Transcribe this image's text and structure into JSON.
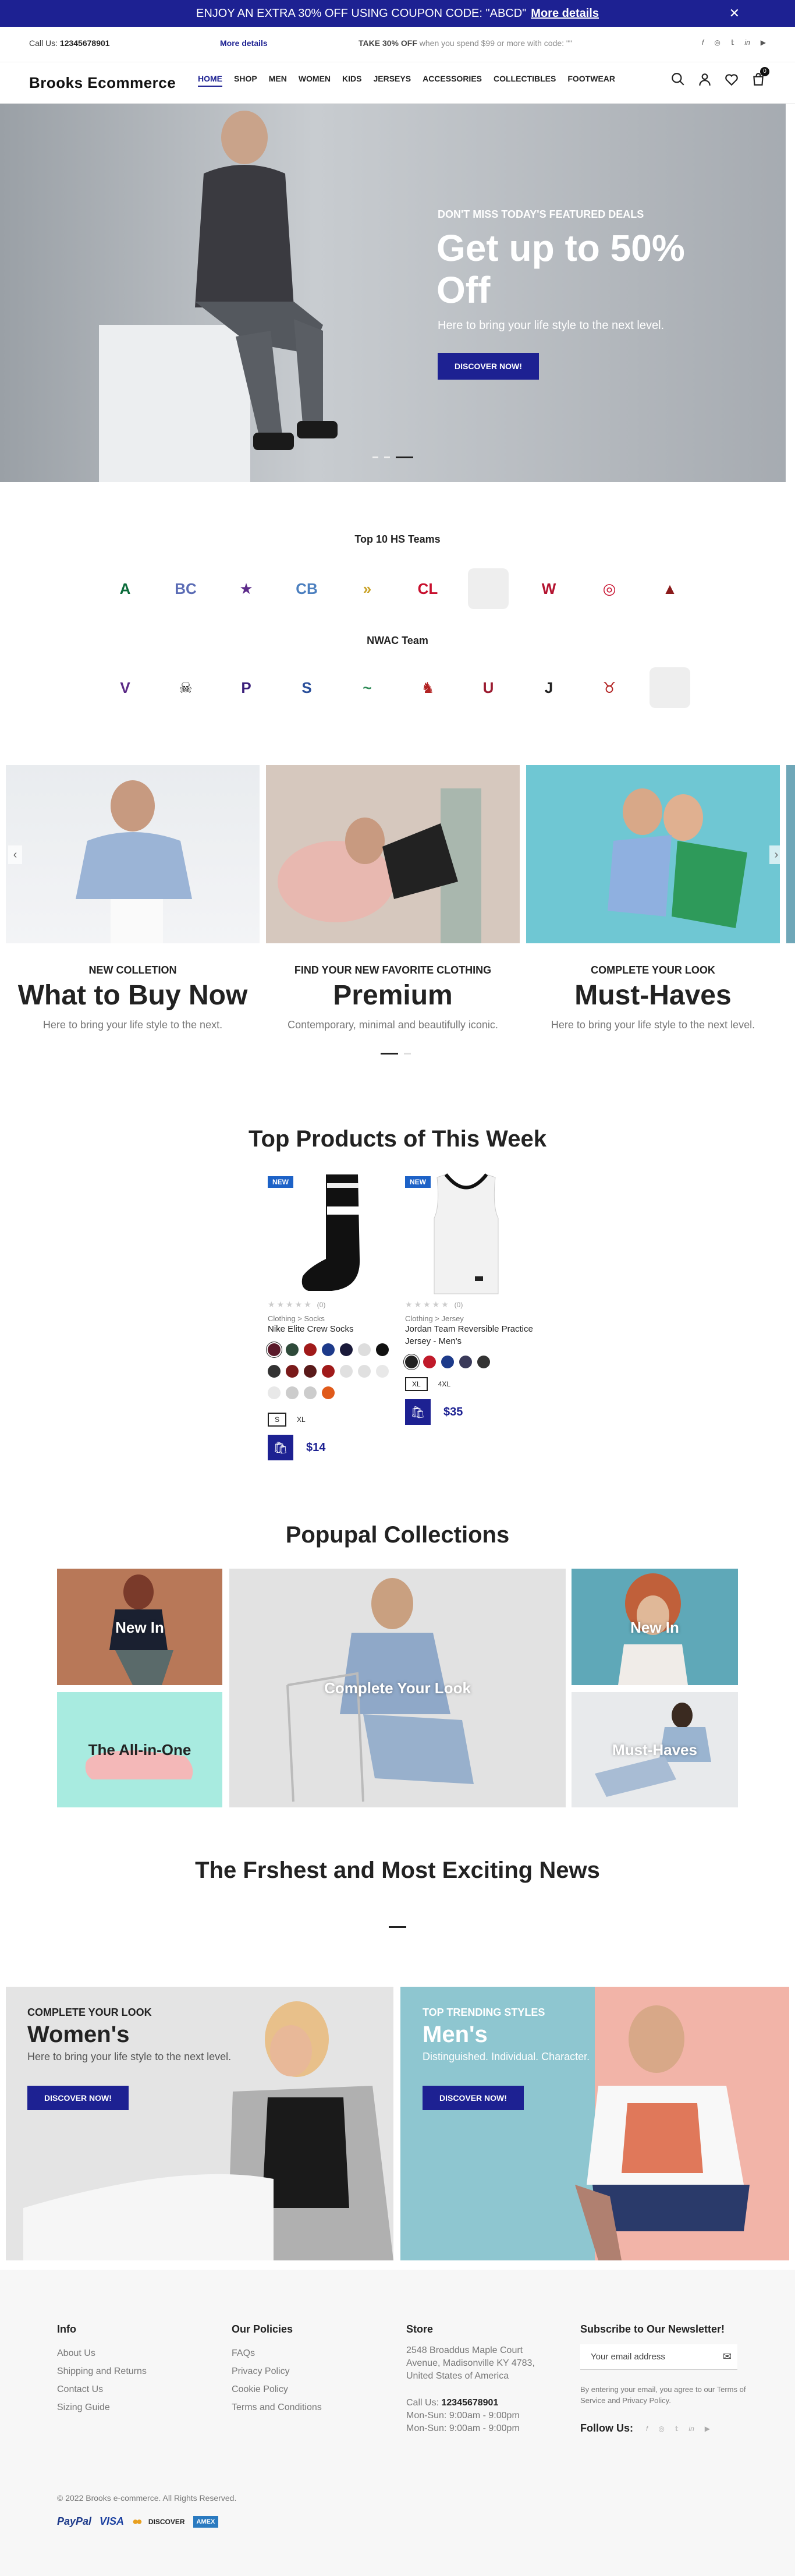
{
  "promo": {
    "text": "ENJOY AN EXTRA 30% OFF USING COUPON CODE: \"ABCD\"",
    "link": "More details",
    "close": "✕"
  },
  "topbar": {
    "call_label": "Call Us:",
    "phone": "12345678901",
    "more": "More details",
    "offer_strong": "TAKE 30% OFF",
    "offer_rest": "when you spend $99 or more with code: \"\"",
    "social": [
      "f",
      "◎",
      "𝕥",
      "in",
      "▶"
    ]
  },
  "header": {
    "logo": "Brooks Ecommerce",
    "menu": [
      "HOME",
      "SHOP",
      "MEN",
      "WOMEN",
      "KIDS",
      "JERSEYS",
      "ACCESSORIES",
      "COLLECTIBLES",
      "FOOTWEAR"
    ],
    "cart_count": "0"
  },
  "hero": {
    "subtitle": "DON'T MISS TODAY'S FEATURED DEALS",
    "title": "Get up to 50% Off",
    "desc": "Here to bring your life style to the next level.",
    "button": "DISCOVER NOW!"
  },
  "teams": {
    "hs_title": "Top 10 HS Teams",
    "hs": [
      {
        "t": "A",
        "c": "#0b6b3a"
      },
      {
        "t": "BC",
        "c": "#5b6cb5"
      },
      {
        "t": "★",
        "c": "#5c2a8a"
      },
      {
        "t": "CB",
        "c": "#4b7fbf"
      },
      {
        "t": "»",
        "c": "#c9a227"
      },
      {
        "t": "CL",
        "c": "#c8102e"
      },
      {
        "t": "",
        "c": "#eeeeee"
      },
      {
        "t": "W",
        "c": "#b3122f"
      },
      {
        "t": "◎",
        "c": "#c8102e"
      },
      {
        "t": "▲",
        "c": "#8a1a1a"
      }
    ],
    "nwac_title": "NWAC Team",
    "nwac": [
      {
        "t": "V",
        "c": "#5b2a86"
      },
      {
        "t": "☠",
        "c": "#222222"
      },
      {
        "t": "P",
        "c": "#3a1f7a"
      },
      {
        "t": "S",
        "c": "#2a4f9a"
      },
      {
        "t": "~",
        "c": "#2e8b57"
      },
      {
        "t": "♞",
        "c": "#b22222"
      },
      {
        "t": "U",
        "c": "#9b1b30"
      },
      {
        "t": "J",
        "c": "#222222"
      },
      {
        "t": "♉",
        "c": "#b22222"
      },
      {
        "t": "",
        "c": "#eeeeee"
      }
    ]
  },
  "collections": [
    {
      "sub": "NEW COLLETION",
      "title": "What to Buy Now",
      "desc": "Here to bring your life style to the next."
    },
    {
      "sub": "FIND YOUR NEW FAVORITE CLOTHING",
      "title": "Premium",
      "desc": "Contemporary, minimal and beautifully iconic."
    },
    {
      "sub": "COMPLETE YOUR LOOK",
      "title": "Must-Haves",
      "desc": "Here to bring your life style to the next level."
    }
  ],
  "products": {
    "title": "Top Products of This Week",
    "items": [
      {
        "badge": "NEW",
        "rating": "(0)",
        "category": "Clothing > Socks",
        "name": "Nike Elite Crew Socks",
        "sizes": [
          "S",
          "XL"
        ],
        "price": "$14",
        "swatches": [
          "#5a1a2a",
          "#2e4a3a",
          "#a01a1a",
          "#1d3a8a",
          "#1a1a3a",
          "#dddddd",
          "#111111",
          "#333333",
          "#7a1a1a",
          "#5a1a1a",
          "#a01a1a",
          "#e0e0e0",
          "#e0e0e0",
          "#e8e8e8",
          "#e8e8e8",
          "#cccccc",
          "#cccccc",
          "#e05a1a"
        ]
      },
      {
        "badge": "NEW",
        "rating": "(0)",
        "category": "Clothing > Jersey",
        "name": "Jordan Team Reversible Practice Jersey - Men's",
        "sizes": [
          "XL",
          "4XL"
        ],
        "price": "$35",
        "swatches": [
          "#222222",
          "#c01a2a",
          "#1d3a8a",
          "#3a3a5a",
          "#333333"
        ]
      }
    ]
  },
  "popupal": {
    "title": "Popupal Collections",
    "tiles": [
      "New In",
      "Complete Your Look",
      "New In",
      "The All-in-One",
      "Must-Haves"
    ]
  },
  "news": {
    "title": "The Frshest and Most Exciting News"
  },
  "banners": [
    {
      "sub": "COMPLETE YOUR LOOK",
      "title": "Women's",
      "desc": "Here to bring your life style to the next level.",
      "button": "DISCOVER NOW!"
    },
    {
      "sub": "TOP TRENDING STYLES",
      "title": "Men's",
      "desc": "Distinguished. Individual. Character.",
      "button": "DISCOVER NOW!"
    }
  ],
  "footer": {
    "info_title": "Info",
    "info": [
      "About Us",
      "Shipping and Returns",
      "Contact Us",
      "Sizing Guide"
    ],
    "policies_title": "Our Policies",
    "policies": [
      "FAQs",
      "Privacy Policy",
      "Cookie Policy",
      "Terms and Conditions"
    ],
    "store_title": "Store",
    "store_address": "2548 Broaddus Maple Court Avenue, Madisonville KY 4783, United States of America",
    "store_call_label": "Call Us:",
    "store_phone": "12345678901",
    "hours1": "Mon-Sun: 9:00am - 9:00pm",
    "hours2": "Mon-Sun: 9:00am - 9:00pm",
    "newsletter_title": "Subscribe to Our Newsletter!",
    "email_placeholder": "Your email address",
    "consent": "By entering your email, you agree to our Terms of Service and Privacy Policy.",
    "follow": "Follow Us:",
    "copyright": "© 2022 Brooks e-commerce. All Rights Reserved.",
    "payments": [
      "PayPal",
      "VISA",
      "●●",
      "DISCOVER",
      "AMEX"
    ]
  }
}
